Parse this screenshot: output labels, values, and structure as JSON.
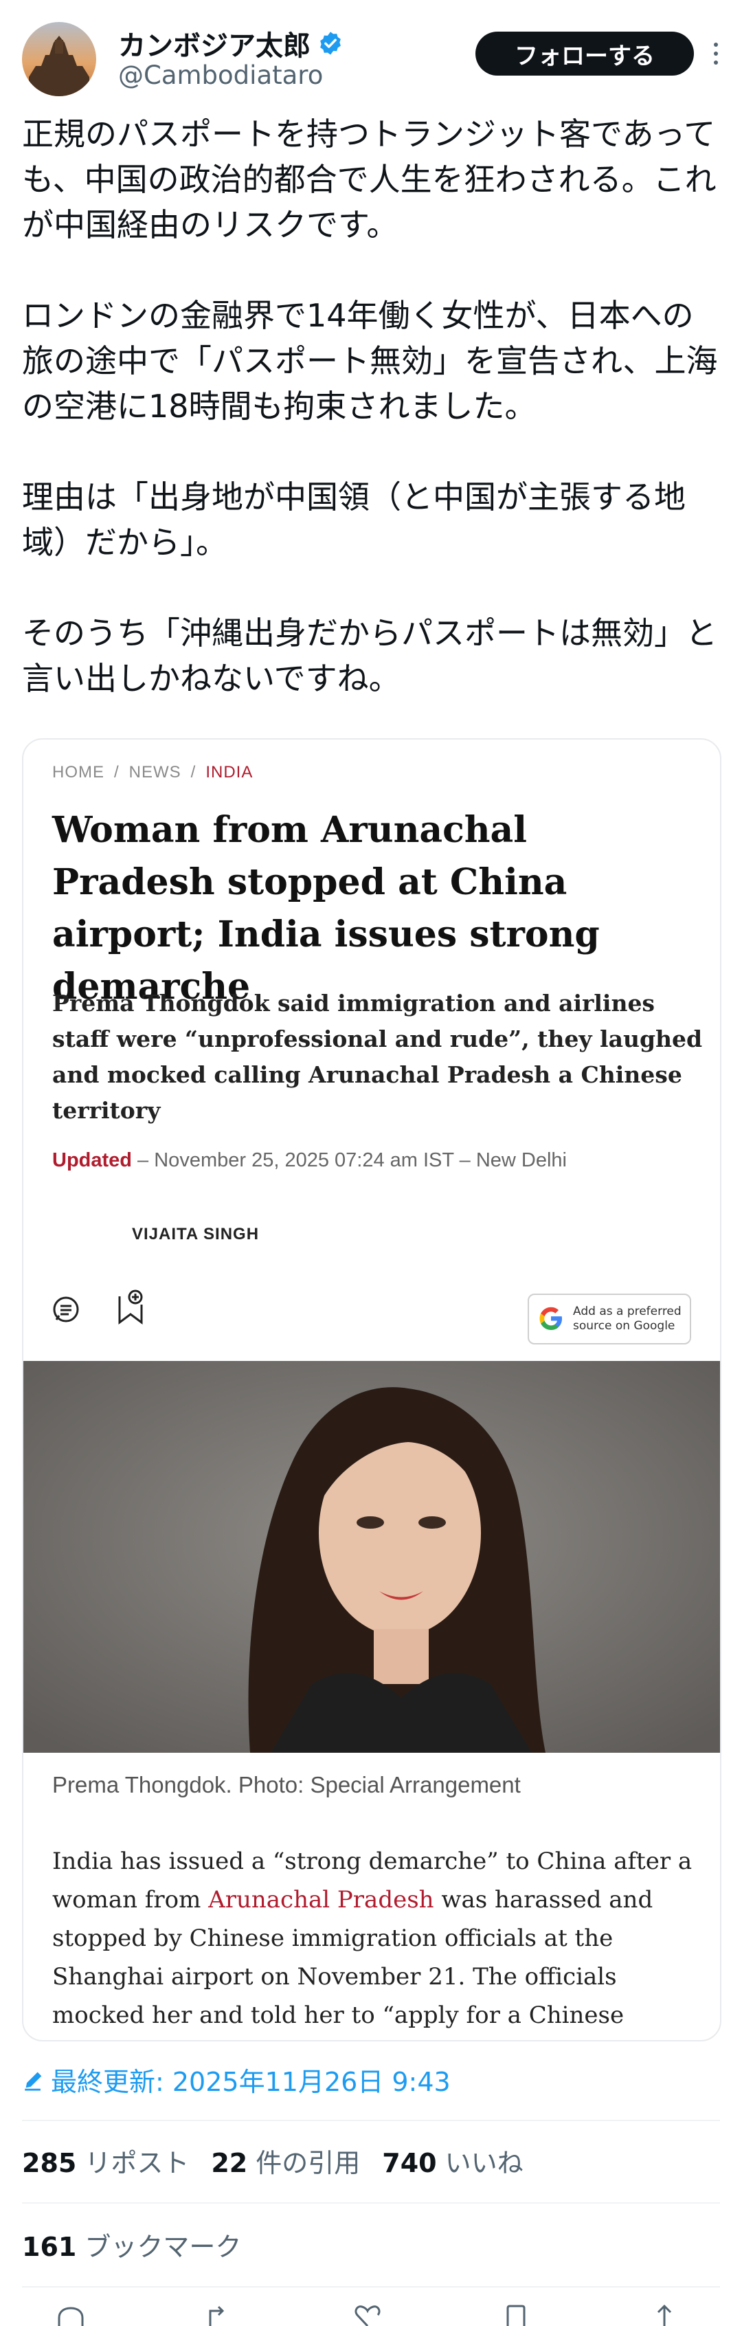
{
  "author": {
    "display_name": "カンボジア太郎",
    "handle": "@Cambodiataro",
    "follow_label": "フォローする"
  },
  "tweet": {
    "text": "正規のパスポートを持つトランジット客であっても、中国の政治的都合で人生を狂わされる。これが中国経由のリスクです。\n\nロンドンの金融界で14年働く女性が、日本への旅の途中で「パスポート無効」を宣告され、上海の空港に18時間も拘束されました。\n\n理由は「出身地が中国領（と中国が主張する地域）だから」。\n\nそのうち「沖縄出身だからパスポートは無効」と言い出しかねないですね。"
  },
  "card": {
    "breadcrumb": [
      "HOME",
      "NEWS",
      "INDIA"
    ],
    "headline": "Woman from Arunachal Pradesh stopped at China airport; India issues strong demarche",
    "subhead": "Prema Thongdok said immigration and airlines staff were “unprofessional and rude”, they laughed and mocked calling Arunachal Pradesh a Chinese territory",
    "updated_label": "Updated",
    "updated_text": " – November 25, 2025 07:24 am IST – New Delhi",
    "author": "VIJAITA SINGH",
    "google_badge": "Add as a preferred source on Google",
    "caption": "Prema Thongdok. Photo: Special Arrangement",
    "body_before": "India has issued a “strong demarche” to China after a woman from ",
    "body_link": "Arunachal Pradesh",
    "body_after": " was harassed and stopped by Chinese immigration officials at the Shanghai airport on November 21. The officials mocked her and told her to “apply for a Chinese passport.”"
  },
  "meta": {
    "edited": "最終更新: 2025年11月26日 9:43",
    "reposts_count": "285",
    "reposts_label": "リポスト",
    "quotes_count": "22",
    "quotes_label": "件の引用",
    "likes_count": "740",
    "likes_label": "いいね",
    "bookmarks_count": "161",
    "bookmarks_label": "ブックマーク"
  },
  "colors": {
    "accent": "#1d9bf0",
    "card_red": "#b01c2e"
  }
}
